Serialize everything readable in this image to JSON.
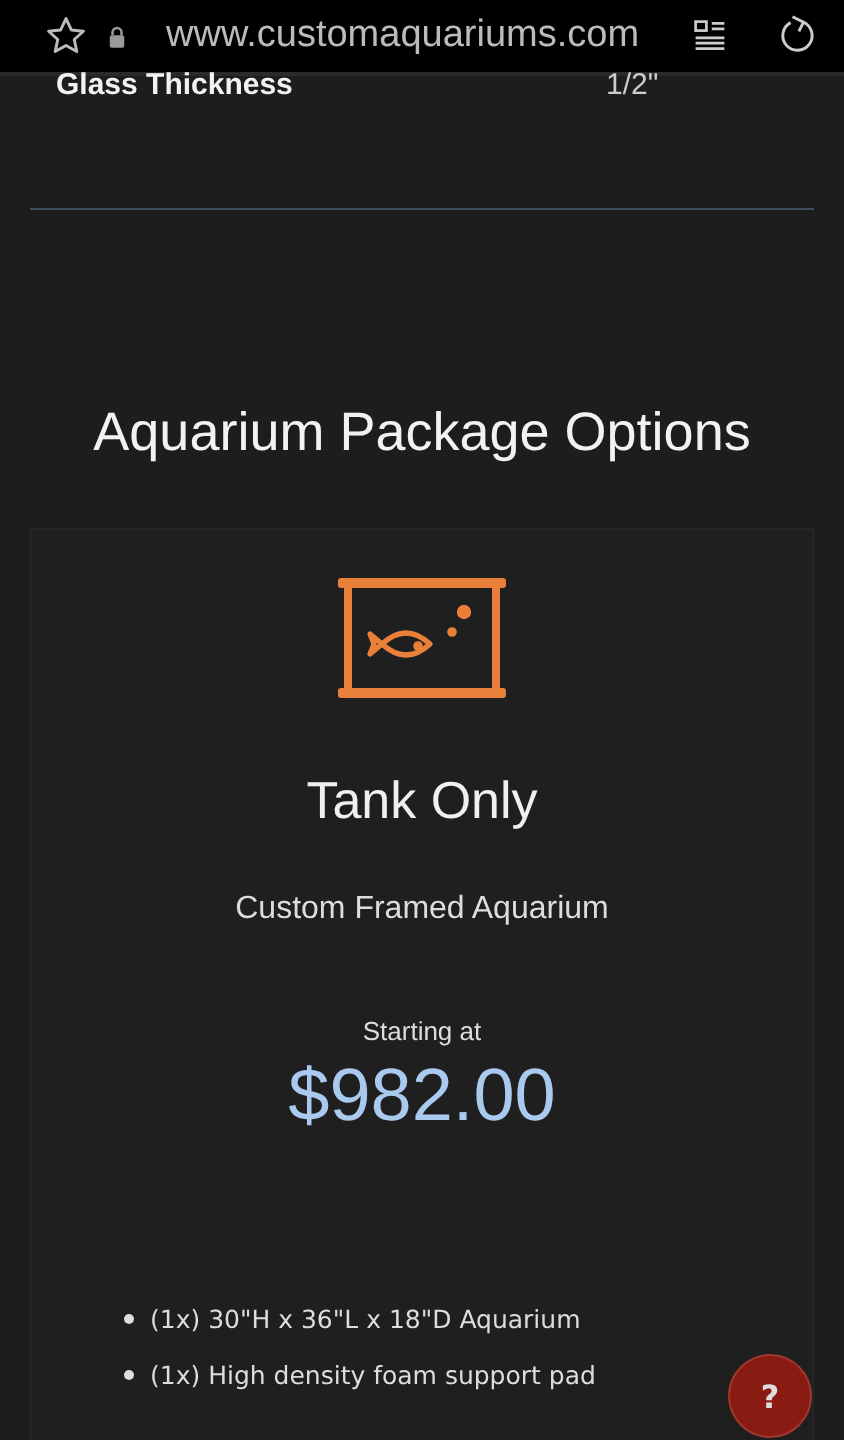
{
  "browser": {
    "url": "www.customaquariums.com"
  },
  "spec_row": {
    "label": "Glass Thickness",
    "value": "1/2\""
  },
  "section_title": "Aquarium Package Options",
  "package": {
    "name": "Tank Only",
    "subtitle": "Custom Framed Aquarium",
    "price_label": "Starting at",
    "price": "$982.00",
    "items": [
      "(1x) 30\"H x 36\"L x 18\"D Aquarium",
      "(1x) High density foam support pad"
    ]
  },
  "help_button": {
    "label": "?"
  }
}
